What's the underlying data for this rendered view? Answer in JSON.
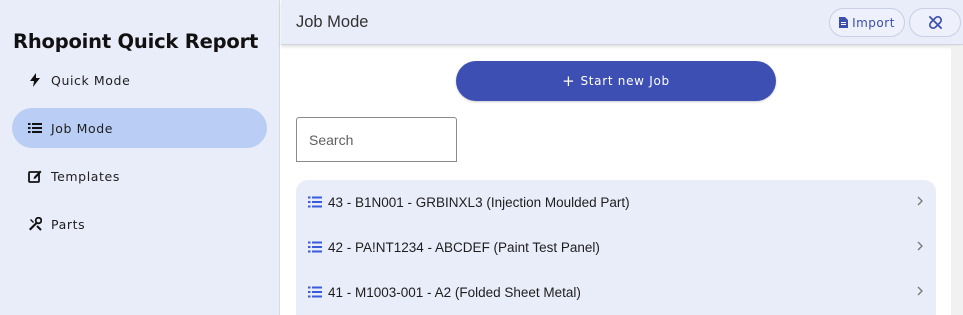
{
  "app": {
    "title": "Rhopoint Quick Report"
  },
  "sidebar": {
    "items": [
      {
        "label": "Quick Mode",
        "icon": "bolt-icon",
        "active": false
      },
      {
        "label": "Job Mode",
        "icon": "list-icon",
        "active": true
      },
      {
        "label": "Templates",
        "icon": "edit-icon",
        "active": false
      },
      {
        "label": "Parts",
        "icon": "tools-icon",
        "active": false
      }
    ]
  },
  "header": {
    "title": "Job Mode",
    "import_label": "Import",
    "import_icon": "file-icon",
    "unlink_icon": "unlink-icon"
  },
  "main": {
    "start_label": "Start new Job",
    "search_placeholder": "Search",
    "jobs": [
      {
        "label": "43 - B1N001 - GRBINXL3 (Injection Moulded Part)"
      },
      {
        "label": "42 - PA!NT1234 - ABCDEF (Paint Test Panel)"
      },
      {
        "label": "41 - M1003-001 - A2 (Folded Sheet Metal)"
      }
    ]
  },
  "colors": {
    "accent": "#3d4fb3",
    "sidebar_bg": "#e9ecf9",
    "active_item": "#b9cdf5",
    "icon_blue": "#3a5bd9"
  }
}
